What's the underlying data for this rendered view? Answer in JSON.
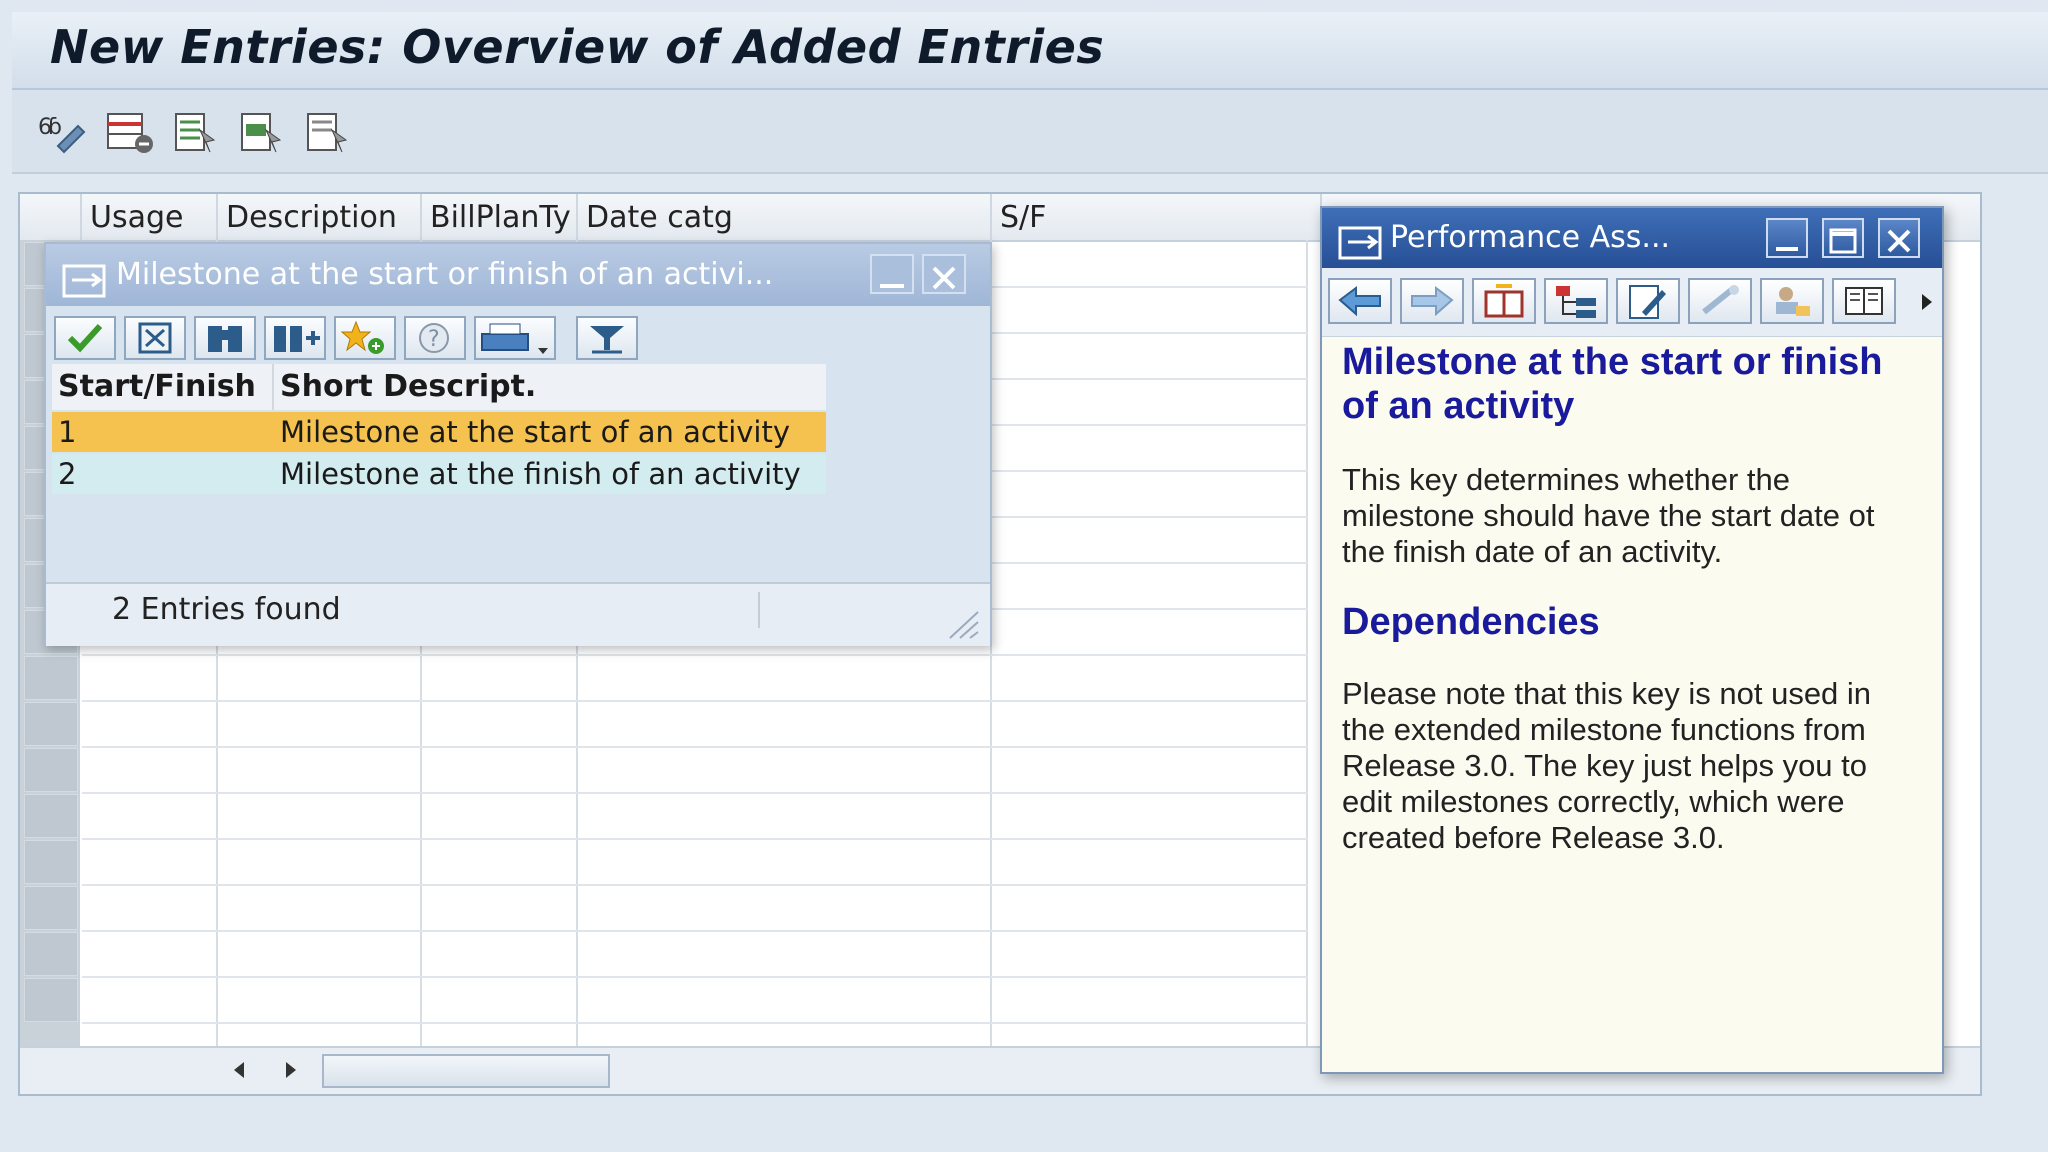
{
  "window": {
    "title": "New Entries: Overview of Added Entries"
  },
  "toolbar": {
    "icons": [
      "display-change-icon",
      "delete-icon",
      "select-all-icon",
      "select-block-icon",
      "deselect-all-icon"
    ]
  },
  "grid": {
    "columns": [
      "Usage",
      "Description",
      "BillPlanTy",
      "Date catg",
      "S/F"
    ]
  },
  "popup1": {
    "title": "Milestone at the start or finish of an activi...",
    "tools": [
      "continue-icon",
      "cancel-icon",
      "find-icon",
      "find-next-icon",
      "favorites-icon",
      "help-icon",
      "print-icon",
      "filter-icon"
    ],
    "headers": [
      "Start/Finish",
      "Short Descript."
    ],
    "rows": [
      {
        "key": "1",
        "text": "Milestone at the start of an activity"
      },
      {
        "key": "2",
        "text": "Milestone at the finish of an activity"
      }
    ],
    "status": "2 Entries found"
  },
  "popup2": {
    "title": "Performance Ass...",
    "heading": "Milestone at the start or finish of an activity",
    "paragraph1": "This key determines whether the milestone should have  the start date ot the finish date of an activity.",
    "subheading": "Dependencies",
    "paragraph2": "Please note that this key is not used in the extended milestone functions from Release 3.0. The key just helps you to edit milestones correctly, which were created before Release 3.0."
  },
  "colors": {
    "accent": "#f6c24f",
    "row2": "#d3ecef",
    "helpHeading": "#1a1a9c"
  }
}
